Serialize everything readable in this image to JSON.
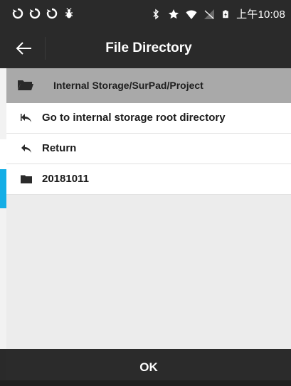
{
  "status_bar": {
    "time": "上午10:08",
    "icons": [
      "sync-icon",
      "sync-icon",
      "sync-icon",
      "debug-icon",
      "bluetooth-icon",
      "star-icon",
      "wifi-icon",
      "no-signal-icon",
      "battery-charging-icon"
    ]
  },
  "app_bar": {
    "title": "File Directory",
    "back_icon": "back-arrow-icon"
  },
  "path_bar": {
    "path": "Internal Storage/SurPad/Project",
    "icon": "folder-open-icon"
  },
  "list": {
    "items": [
      {
        "label": "Go to internal storage root directory",
        "icon": "reply-all-icon"
      },
      {
        "label": "Return",
        "icon": "reply-icon"
      },
      {
        "label": "20181011",
        "icon": "folder-icon"
      }
    ]
  },
  "footer": {
    "ok_label": "OK"
  },
  "colors": {
    "bar_dark": "#2a2a2a",
    "path_bar": "#a9a9a9",
    "list_bg": "#ffffff",
    "empty_bg": "#ececec",
    "accent_strip": "#14aee6"
  }
}
